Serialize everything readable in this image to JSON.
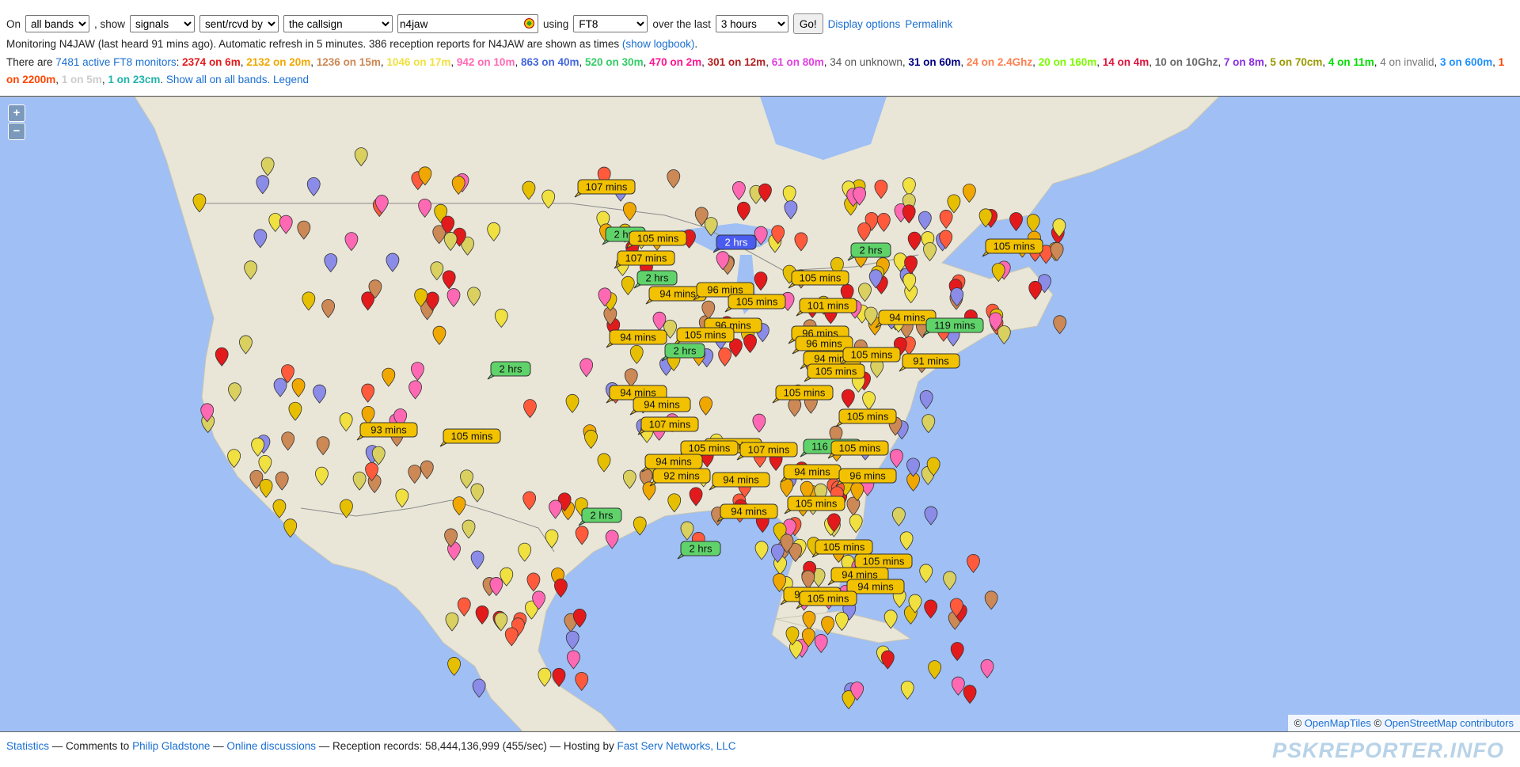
{
  "controls": {
    "on_label": "On",
    "band": "all bands",
    "show_label": ", show",
    "show": "signals",
    "direction": "sent/rcvd by",
    "target": "the callsign",
    "callsign": "n4jaw",
    "using_label": "using",
    "mode": "FT8",
    "period_label": "over the last",
    "period": "3 hours",
    "go_label": "Go!",
    "display_options": "Display options",
    "permalink": "Permalink"
  },
  "status": {
    "monitoring_text": "Monitoring N4JAW (last heard 91 mins ago). Automatic refresh in 5 minutes. 386 reception reports for N4JAW are shown as times",
    "logbook_link": "(show logbook)",
    "period_end": "."
  },
  "monitors": {
    "prefix": "There are",
    "link": "7481 active FT8 monitors",
    "colon": ":",
    "bands": [
      {
        "text": "2374 on 6m",
        "color": "#e31a1c"
      },
      {
        "text": "2132 on 20m",
        "color": "#f0a800"
      },
      {
        "text": "1236 on 15m",
        "color": "#cc8855"
      },
      {
        "text": "1046 on 17m",
        "color": "#f0e040"
      },
      {
        "text": "942 on 10m",
        "color": "#ff69b4"
      },
      {
        "text": "863 on 40m",
        "color": "#4466dd"
      },
      {
        "text": "520 on 30m",
        "color": "#33cc66"
      },
      {
        "text": "470 on 2m",
        "color": "#ff1493"
      },
      {
        "text": "301 on 12m",
        "color": "#b22222"
      },
      {
        "text": "61 on 80m",
        "color": "#e040e0"
      },
      {
        "text": "34 on unknown",
        "color": "#555555"
      },
      {
        "text": "31 on 60m",
        "color": "#000080"
      },
      {
        "text": "24 on 2.4Ghz",
        "color": "#ff7f50"
      },
      {
        "text": "20 on 160m",
        "color": "#7cfc00"
      },
      {
        "text": "14 on 4m",
        "color": "#dc143c"
      },
      {
        "text": "10 on 10Ghz",
        "color": "#696969"
      },
      {
        "text": "7 on 8m",
        "color": "#8a2be2"
      },
      {
        "text": "5 on 70cm",
        "color": "#999900"
      },
      {
        "text": "4 on 11m",
        "color": "#00dd00"
      },
      {
        "text": "4 on invalid",
        "color": "#777777"
      },
      {
        "text": "3 on 600m",
        "color": "#1e90ff"
      },
      {
        "text": "1 on 2200m",
        "color": "#ff4500"
      },
      {
        "text": "1 on 5m",
        "color": "#cccccc"
      },
      {
        "text": "1 on 23cm",
        "color": "#20b2aa"
      }
    ],
    "show_all": "Show all on all bands.",
    "legend": "Legend"
  },
  "map": {
    "zoom_in": "+",
    "zoom_out": "−",
    "labels": [
      "107 mins",
      "2 hrs",
      "105 mins",
      "2 hrs",
      "107 mins",
      "2 hrs",
      "105 mins",
      "2 hrs",
      "105 mins",
      "94 mins",
      "96 mins",
      "105 mins",
      "101 mins",
      "96 mins",
      "96 mins",
      "94 mins",
      "119 mins",
      "94 mins",
      "105 mins",
      "96 mins",
      "2 hrs",
      "94 mins",
      "105 mins",
      "2 hrs",
      "105 mins",
      "91 mins",
      "94 mins",
      "105 mins",
      "94 mins",
      "105 mins",
      "93 mins",
      "105 mins",
      "107 mins",
      "105 mins",
      "116 mins",
      "105 mins",
      "105 mins",
      "107 mins",
      "94 mins",
      "92 mins",
      "94 mins",
      "94 mins",
      "96 mins",
      "2 hrs",
      "105 mins",
      "94 mins",
      "105 mins",
      "2 hrs",
      "105 mins",
      "94 mins",
      "94 mins",
      "96 mins",
      "105 mins"
    ],
    "attribution_symbol": "©",
    "tiles_link": "OpenMapTiles",
    "osm_link": "OpenStreetMap contributors"
  },
  "footer": {
    "statistics": "Statistics",
    "comments": "— Comments to",
    "author": "Philip Gladstone",
    "sep": "—",
    "discussions": "Online discussions",
    "records": "— Reception records: 58,444,136,999 (455/sec) — Hosting by",
    "host": "Fast Serv Networks, LLC",
    "brand": "PSKREPORTER.INFO"
  },
  "colors": {
    "water": "#9fbff5",
    "land": "#e9e6d8",
    "label_gold": "#f2c200",
    "label_green": "#5fd36a",
    "label_blue": "#4a5cf0"
  }
}
